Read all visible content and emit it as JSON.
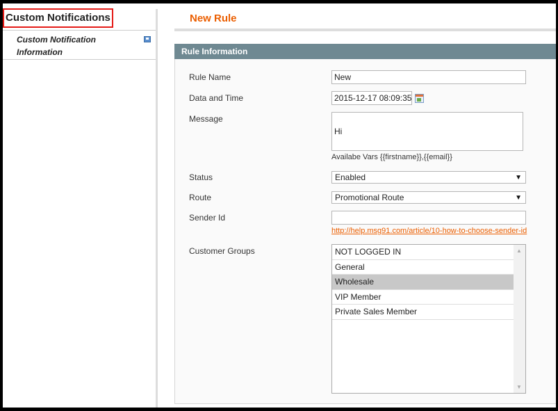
{
  "sidebar": {
    "title": "Custom Notifications",
    "items": [
      {
        "label": "Custom Notification Information",
        "icon": "save-icon"
      }
    ]
  },
  "main": {
    "page_title": "New Rule",
    "fieldset_title": "Rule Information",
    "fields": {
      "rule_name": {
        "label": "Rule Name",
        "value": "New"
      },
      "date_time": {
        "label": "Data and Time",
        "value": "2015-12-17 08:09:35",
        "icon": "calendar-icon"
      },
      "message": {
        "label": "Message",
        "value": "Hi",
        "note": "Availabe Vars {{firstname}},{{email}}"
      },
      "status": {
        "label": "Status",
        "value": "Enabled"
      },
      "route": {
        "label": "Route",
        "value": "Promotional Route"
      },
      "sender_id": {
        "label": "Sender Id",
        "value": "",
        "link": "http://help.msg91.com/article/10-how-to-choose-sender-id"
      },
      "customer_groups": {
        "label": "Customer Groups",
        "options": [
          "NOT LOGGED IN",
          "General",
          "Wholesale",
          "VIP Member",
          "Private Sales Member"
        ],
        "selected": "Wholesale"
      }
    }
  },
  "colors": {
    "accent": "#eb5e00",
    "fieldset_header": "#6f8992",
    "highlight": "#e41b17"
  }
}
